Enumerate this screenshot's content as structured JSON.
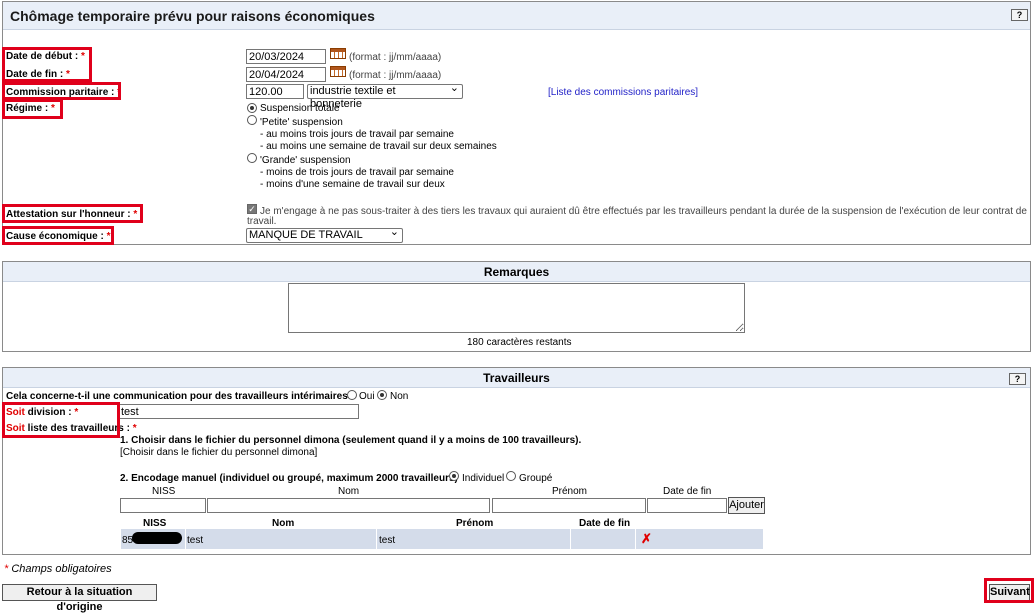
{
  "header": {
    "title": "Chômage temporaire prévu pour raisons économiques",
    "help": "?"
  },
  "form": {
    "date_debut": {
      "label": "Date de début :",
      "value": "20/03/2024",
      "format": "(format : jj/mm/aaaa)"
    },
    "date_fin": {
      "label": "Date de fin :",
      "value": "20/04/2024",
      "format": "(format : jj/mm/aaaa)"
    },
    "commission": {
      "label": "Commission paritaire :",
      "code": "120.00",
      "selected": "industrie textile et bonneterie",
      "link": "[Liste des commissions paritaires]"
    },
    "regime": {
      "label": "Régime :",
      "option_totale": "Suspension totale",
      "option_petite": "'Petite' suspension",
      "petite_line1": "- au moins trois jours de travail par semaine",
      "petite_line2": "- au moins une semaine de travail sur deux semaines",
      "option_grande": "'Grande' suspension",
      "grande_line1": "- moins de trois jours de travail par semaine",
      "grande_line2": "- moins d'une semaine de travail sur deux"
    },
    "attestation": {
      "label": "Attestation sur l'honneur :",
      "text1": "Je m'engage à ne pas sous-traiter à des tiers les travaux qui auraient dû être effectués par les travailleurs pendant la durée de la suspension de l'exécution de leur contrat de",
      "text2": "travail."
    },
    "cause": {
      "label": "Cause économique :",
      "selected": "MANQUE DE TRAVAIL"
    },
    "required": "*"
  },
  "remarques": {
    "title": "Remarques",
    "remaining": "180 caractères restants"
  },
  "travailleurs": {
    "title": "Travailleurs",
    "interim_question": "Cela concerne-t-il une communication pour des travailleurs intérimaires ?",
    "oui": "Oui",
    "non": "Non",
    "soit": "Soit",
    "division_label": "division :",
    "division_value": "test",
    "liste_label": "liste des travailleurs :",
    "step1": "1. Choisir dans le fichier du personnel dimona (seulement quand il y a moins de 100 travailleurs).",
    "step1_link": "[Choisir dans le fichier du personnel dimona]",
    "step2": "2. Encodage manuel (individuel ou groupé, maximum 2000 travailleurs)",
    "individuel": "Individuel",
    "groupe": "Groupé",
    "input_headers": [
      "NISS",
      "Nom",
      "Prénom",
      "Date de fin"
    ],
    "add_button": "Ajouter",
    "table_headers": [
      "NISS",
      "Nom",
      "Prénom",
      "Date de fin"
    ],
    "rows": [
      {
        "niss": "85",
        "nom": "test",
        "prenom": "test",
        "date_fin": "",
        "delete": "✗"
      }
    ]
  },
  "footer": {
    "mandatory_note": "Champs obligatoires",
    "back_button": "Retour à la situation d'origine",
    "next_button": "Suivant"
  }
}
